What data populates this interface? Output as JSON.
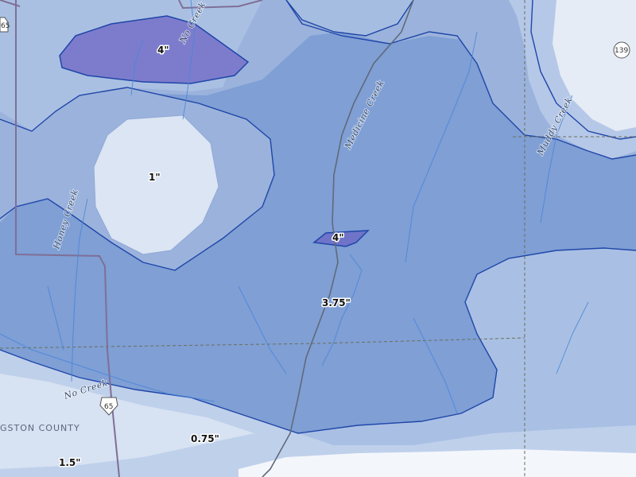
{
  "map": {
    "contour_labels": {
      "nw_4": "4\"",
      "center_4": "4\"",
      "west_1": "1\"",
      "main_375": "3.75\"",
      "south_075": "0.75\"",
      "sw_15": "1.5\""
    },
    "creek_labels": {
      "no_creek_north": "No Creek",
      "medicine_creek": "Medicine Creek",
      "muddy_creek": "Muddy Creek",
      "honey_creek": "Honey Creek",
      "no_creek_south": "No Creek"
    },
    "county_label": "GSTON COUNTY",
    "route_shields": {
      "hwy_65_north": "65",
      "hwy_65_south": "65",
      "hwy_139": "139"
    },
    "colors": {
      "band_light": "#e6edf6",
      "band_low": "#b9cbe6",
      "band_mid": "#94afdb",
      "band_high": "#7a98d3",
      "band_peak": "#7d7ccc",
      "contour_line": "#1f46a8",
      "water": "#4a86d8",
      "road": "#7f6f96"
    }
  }
}
